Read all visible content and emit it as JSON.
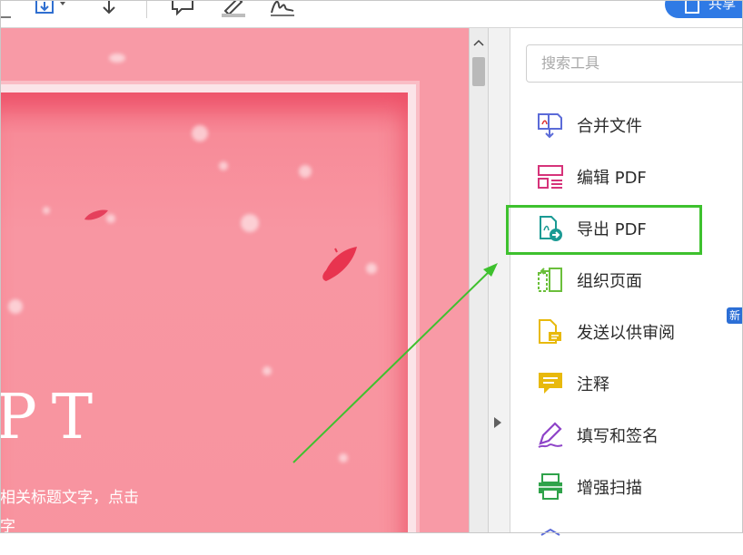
{
  "toolbar": {
    "share_label": "共享",
    "icons": [
      "save-as-icon",
      "download-icon",
      "comment-icon",
      "highlight-pen-icon",
      "sign-icon"
    ]
  },
  "document": {
    "big_text": "PT",
    "subtitle_line1": "相关标题文字，点击",
    "subtitle_line2": "字"
  },
  "tools_pane": {
    "search_placeholder": "搜索工具",
    "new_badge": "新",
    "tools": [
      {
        "label": "合并文件",
        "icon": "combine-files-icon",
        "color": "#5b6bd8"
      },
      {
        "label": "编辑 PDF",
        "icon": "edit-pdf-icon",
        "color": "#d6337a"
      },
      {
        "label": "导出 PDF",
        "icon": "export-pdf-icon",
        "color": "#1a9a94",
        "highlighted": true
      },
      {
        "label": "组织页面",
        "icon": "organize-pages-icon",
        "color": "#6bbf3b"
      },
      {
        "label": "发送以供审阅",
        "icon": "send-for-review-icon",
        "color": "#e8b90c"
      },
      {
        "label": "注释",
        "icon": "comment-tool-icon",
        "color": "#e8b90c"
      },
      {
        "label": "填写和签名",
        "icon": "fill-sign-icon",
        "color": "#8e44c8"
      },
      {
        "label": "增强扫描",
        "icon": "enhance-scan-icon",
        "color": "#2fa24a"
      }
    ]
  },
  "colors": {
    "accent": "#2f7ae5",
    "highlight": "#3ec12e",
    "slide_bg": "#f89aa6"
  }
}
